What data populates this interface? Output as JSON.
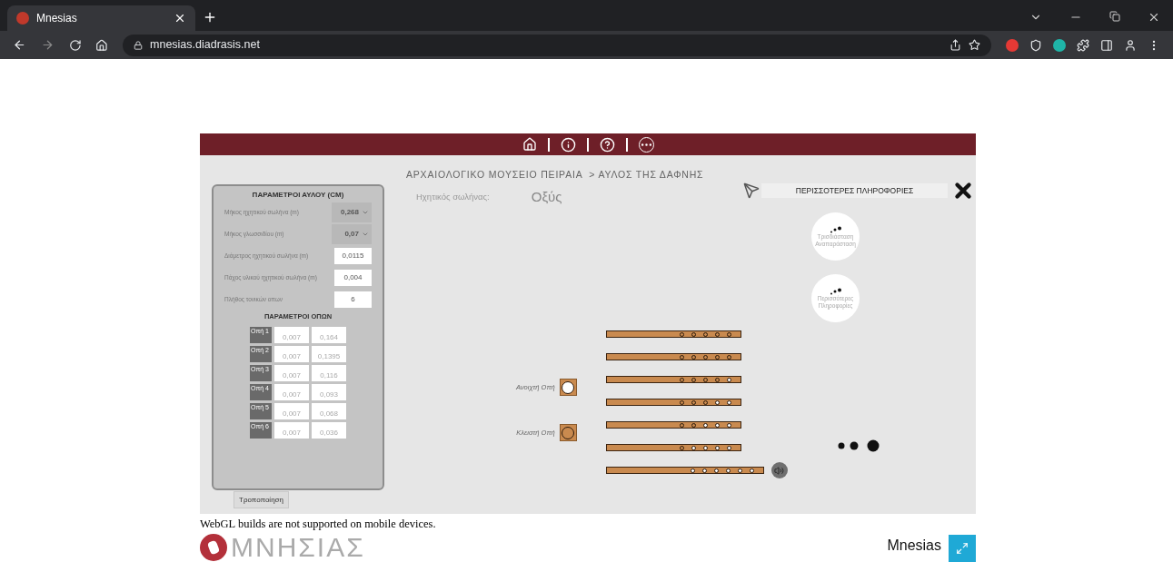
{
  "browser": {
    "tab_title": "Mnesias",
    "url": "mnesias.diadrasis.net"
  },
  "app": {
    "breadcrumb": "ΑΡΧΑΙΟΛΟΓΙΚΟ ΜΟΥΣΕΙΟ ΠΕΙΡΑΙΑ  > ΑΥΛΟΣ ΤΗΣ ΔΑΦΝΗΣ",
    "tube_label": "Ηχητικός σωλήνας:",
    "tube_value": "Οξύς",
    "parameters": {
      "title": "ΠΑΡΑΜΕΤΡΟΙ ΑΥΛΟΥ (CM)",
      "fields": [
        {
          "label": "Μήκος ηχητικού σωλήνα (m)",
          "value": "0,268",
          "kind": "dropdown"
        },
        {
          "label": "Μήκος γλωσσιδίου (m)",
          "value": "0,07",
          "kind": "dropdown"
        },
        {
          "label": "Διάμετρος ηχητικού σωλήνα (m)",
          "value": "0,0115",
          "kind": "input"
        },
        {
          "label": "Πάχος υλικού ηχητικού σωλήνα (m)",
          "value": "0,004",
          "kind": "input"
        },
        {
          "label": "Πλήθος τονικών οπων",
          "value": "6",
          "kind": "input"
        }
      ],
      "holes_title": "ΠΑΡΑΜΕΤΡΟΙ ΟΠΩΝ",
      "holes": [
        {
          "label": "Οπή 1",
          "diameter": "0,007",
          "distance": "0,164"
        },
        {
          "label": "Οπή 2",
          "diameter": "0,007",
          "distance": "0,1395"
        },
        {
          "label": "Οπή 3",
          "diameter": "0,007",
          "distance": "0,116"
        },
        {
          "label": "Οπή 4",
          "diameter": "0,007",
          "distance": "0,093"
        },
        {
          "label": "Οπή 5",
          "diameter": "0,007",
          "distance": "0,068"
        },
        {
          "label": "Οπή 6",
          "diameter": "0,007",
          "distance": "0,036"
        }
      ],
      "modify_button": "Τροποποίηση"
    },
    "legend": [
      {
        "label": "Ανοιχτή Οπή",
        "open": true
      },
      {
        "label": "Κλειστή Οπή",
        "open": false
      }
    ],
    "flutes": [
      {
        "holes": [
          {
            "open": false
          },
          {
            "open": false
          },
          {
            "open": false
          },
          {
            "open": false
          },
          {
            "open": false
          }
        ],
        "sound": false
      },
      {
        "holes": [
          {
            "open": false
          },
          {
            "open": false
          },
          {
            "open": false
          },
          {
            "open": false
          },
          {
            "open": false
          }
        ],
        "sound": false
      },
      {
        "holes": [
          {
            "open": false
          },
          {
            "open": false
          },
          {
            "open": false
          },
          {
            "open": false
          },
          {
            "open": true
          }
        ],
        "sound": false
      },
      {
        "holes": [
          {
            "open": false
          },
          {
            "open": false
          },
          {
            "open": false
          },
          {
            "open": true
          },
          {
            "open": true
          }
        ],
        "sound": false
      },
      {
        "holes": [
          {
            "open": false
          },
          {
            "open": false
          },
          {
            "open": true
          },
          {
            "open": true
          },
          {
            "open": true
          }
        ],
        "sound": false
      },
      {
        "holes": [
          {
            "open": false
          },
          {
            "open": true
          },
          {
            "open": true
          },
          {
            "open": true
          },
          {
            "open": true
          }
        ],
        "sound": false
      },
      {
        "holes": [
          {
            "open": true
          },
          {
            "open": true
          },
          {
            "open": true
          },
          {
            "open": true
          },
          {
            "open": true
          },
          {
            "open": true
          }
        ],
        "sound": true
      }
    ],
    "info_bar": "ΠΕΡΙΣΣΟΤΕΡΕΣ ΠΛΗΡΟΦΟΡΙΕΣ",
    "circle_buttons": [
      "Τρισδιάσταση Αναπαράσταση",
      "Περισσότερες Πληροφορίες"
    ]
  },
  "footer": {
    "notice": "WebGL builds are not supported on mobile devices.",
    "logo_text": "ΜΝΗΣΙΑΣ",
    "title": "Mnesias"
  }
}
